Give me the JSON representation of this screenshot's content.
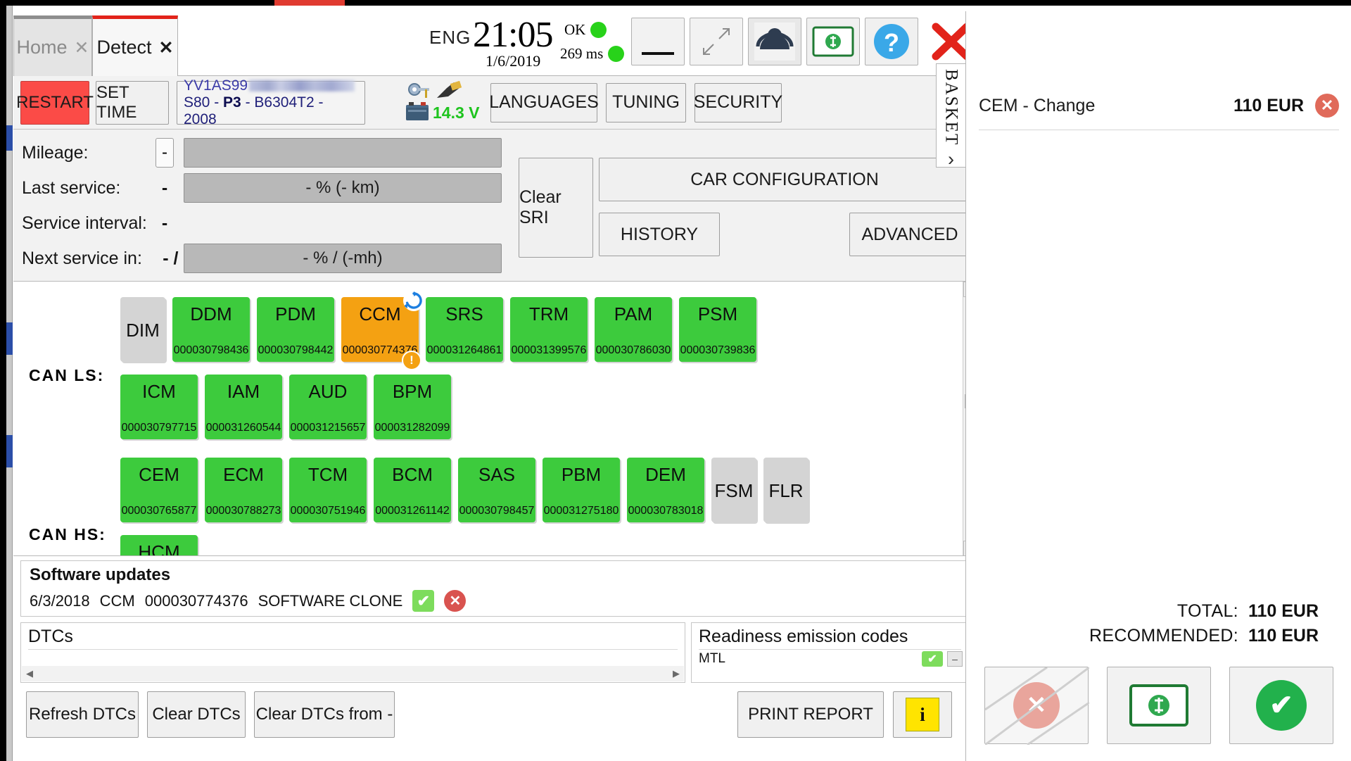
{
  "tabs": [
    {
      "label": "Home",
      "close": "✕",
      "active": false
    },
    {
      "label": "Detect",
      "close": "✕",
      "active": true
    }
  ],
  "header": {
    "language": "ENG",
    "time": "21:05",
    "date": "1/6/2019",
    "status_ok_label": "OK",
    "latency_label": "269 ms",
    "led_color": "#28d21a",
    "buttons": {
      "minimize": "minimize-button",
      "resize": "resize-button",
      "support": "support-button",
      "money": "money-button",
      "help": "?",
      "close": "✕"
    }
  },
  "toolbar": {
    "restart": "RESTART",
    "set_time": "SET TIME",
    "vehicle": {
      "vin_prefix": "YV1AS99",
      "model": "S80",
      "platform": "P3",
      "engine": "B6304T2",
      "year": "2008",
      "sep": " - "
    },
    "voltage": "14.3 V",
    "languages": "LANGUAGES",
    "tuning": "TUNING",
    "security": "SECURITY"
  },
  "service": {
    "rows": [
      {
        "label": "Mileage:",
        "value": "-",
        "bar": ""
      },
      {
        "label": "Last service:",
        "value": "-",
        "bar": "- % (- km)"
      },
      {
        "label": "Service interval:",
        "value": "-",
        "bar": ""
      },
      {
        "label": "Next service in:",
        "value": "- / -",
        "bar": "- % / (-mh)"
      }
    ],
    "clear_sri": "Clear SRI",
    "car_configuration": "CAR CONFIGURATION",
    "history": "HISTORY",
    "advanced": "ADVANCED"
  },
  "modules": {
    "bus_ls_label": "CAN LS:",
    "bus_hs_label": "CAN HS:",
    "row1": [
      {
        "name": "DIM",
        "code": "",
        "state": "grey"
      },
      {
        "name": "DDM",
        "code": "000030798436",
        "state": "green"
      },
      {
        "name": "PDM",
        "code": "000030798442",
        "state": "green"
      },
      {
        "name": "CCM",
        "code": "000030774376",
        "state": "orange",
        "refresh": true,
        "warning": true
      },
      {
        "name": "SRS",
        "code": "000031264861",
        "state": "green"
      },
      {
        "name": "TRM",
        "code": "000031399576",
        "state": "green"
      },
      {
        "name": "PAM",
        "code": "000030786030",
        "state": "green"
      },
      {
        "name": "PSM",
        "code": "000030739836",
        "state": "green"
      }
    ],
    "row2": [
      {
        "name": "ICM",
        "code": "000030797715",
        "state": "green"
      },
      {
        "name": "IAM",
        "code": "000031260544",
        "state": "green"
      },
      {
        "name": "AUD",
        "code": "000031215657",
        "state": "green"
      },
      {
        "name": "BPM",
        "code": "000031282099",
        "state": "green"
      }
    ],
    "row3": [
      {
        "name": "CEM",
        "code": "000030765877",
        "state": "green"
      },
      {
        "name": "ECM",
        "code": "000030788273",
        "state": "green"
      },
      {
        "name": "TCM",
        "code": "000030751946",
        "state": "green"
      },
      {
        "name": "BCM",
        "code": "000031261142",
        "state": "green"
      },
      {
        "name": "SAS",
        "code": "000030798457",
        "state": "green"
      },
      {
        "name": "PBM",
        "code": "000031275180",
        "state": "green"
      },
      {
        "name": "DEM",
        "code": "000030783018",
        "state": "green"
      },
      {
        "name": "FSM",
        "code": "",
        "state": "grey"
      },
      {
        "name": "FLR",
        "code": "",
        "state": "grey"
      }
    ],
    "row4": [
      {
        "name": "HCM",
        "code": "",
        "state": "green"
      }
    ]
  },
  "software_updates": {
    "title": "Software updates",
    "entry": {
      "date": "6/3/2018",
      "module": "CCM",
      "code": "000030774376",
      "description": "SOFTWARE CLONE",
      "accept": "✔",
      "reject": "✕"
    }
  },
  "dtcs": {
    "title": "DTCs",
    "scroll_left": "◀",
    "scroll_right": "▶"
  },
  "readiness": {
    "title": "Readiness emission codes",
    "row_label": "MTL",
    "row_ok": "✔",
    "row_mini": "–"
  },
  "bottom": {
    "refresh_dtcs": "Refresh DTCs",
    "clear_dtcs": "Clear DTCs",
    "clear_dtcs_from": "Clear DTCs from -",
    "print_report": "PRINT REPORT",
    "info": "i"
  },
  "basket": {
    "tab_label": "BASKET",
    "tab_chevron": "›",
    "items": [
      {
        "name": "CEM - Change",
        "price": "110 EUR",
        "remove": "✕"
      }
    ],
    "total_label": "TOTAL:",
    "total_value": "110 EUR",
    "recommended_label": "RECOMMENDED:",
    "recommended_value": "110 EUR",
    "actions": {
      "cancel": "✕",
      "pay": "money-icon",
      "confirm": "✔"
    }
  }
}
